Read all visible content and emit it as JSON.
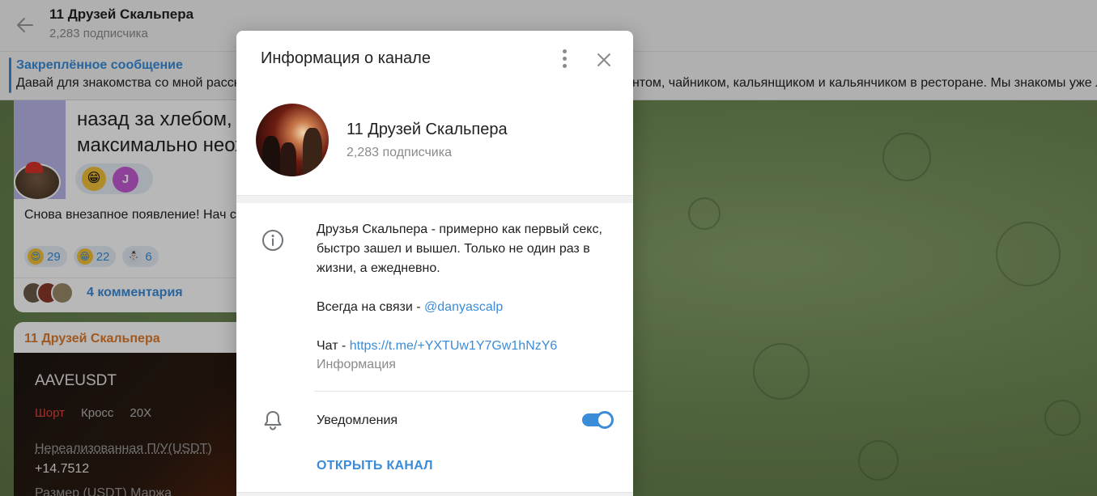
{
  "header": {
    "title": "11 Друзей Скальпера",
    "subscribers": "2,283 подписчика"
  },
  "pinned": {
    "title": "Закреплённое сообщение",
    "text": "Давай для знакомства со мной расскажу тебе историю, как мы познакомились с моим другом официантом, чайником, кальянщиком и кальянчиком в ресторане. Мы знакомы уже лет одиннадцать, ещё"
  },
  "message1": {
    "big_text_line1": "назад за хлебом, н",
    "big_text_line2": "максимально неож",
    "j_avatar": "J",
    "text": "Снова внезапное появление! Нач сейчас?",
    "reactions": [
      {
        "emoji": "😍",
        "count": "29"
      },
      {
        "emoji": "😁",
        "count": "22"
      },
      {
        "emoji": "⛄",
        "count": "6"
      }
    ],
    "comments_label": "4 комментария"
  },
  "message2": {
    "author": "11 Друзей Скальпера",
    "symbol": "AAVEUSDT",
    "side": "Шорт",
    "margin": "Кросс",
    "leverage": "20X",
    "pnl_label": "Нереализованная П/У(USDT)",
    "pnl_value": "+14.7512",
    "size_label": "Размер (USDT)       Маржа"
  },
  "modal": {
    "title": "Информация о канале",
    "channel_name": "11 Друзей Скальпера",
    "subscribers": "2,283 подписчика",
    "description": "Друзья Скальпера - примерно как первый секс, быстро зашел и вышел. Только не один раз в жизни, а ежедневно.",
    "contact_prefix": "Всегда на связи - ",
    "contact_handle": "@danyascalp",
    "chat_prefix": "Чат - ",
    "chat_link": "https://t.me/+YXTUw1Y7Gw1hNzY6",
    "info_caption": "Информация",
    "notifications_label": "Уведомления",
    "notifications_on": true,
    "open_channel": "ОТКРЫТЬ КАНАЛ"
  },
  "colors": {
    "accent": "#3a8cd8",
    "author": "#e07a2a",
    "short": "#e0453a"
  }
}
